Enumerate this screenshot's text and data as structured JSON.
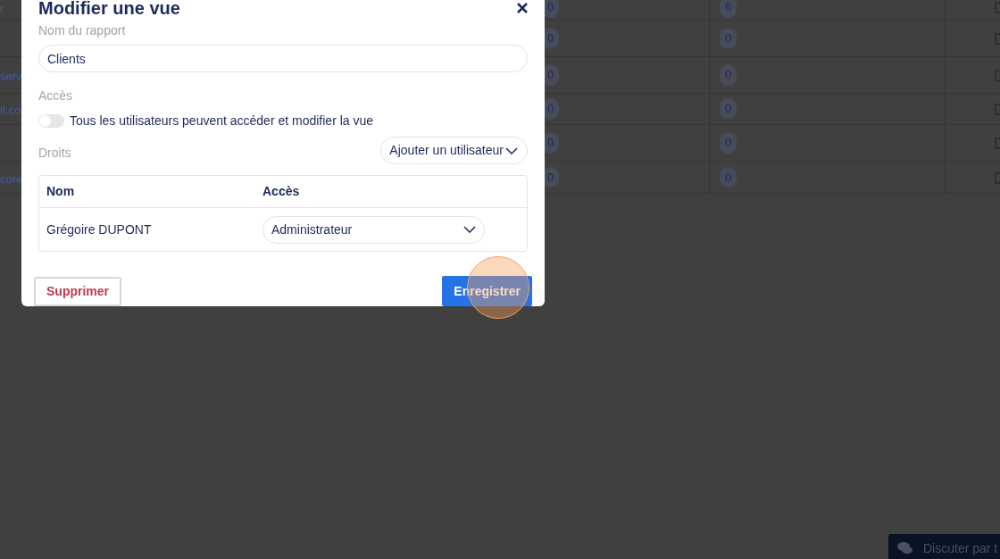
{
  "background_table": {
    "rows": [
      {
        "column_1": "r",
        "column_2": "0",
        "column_3": "6"
      },
      {
        "column_2": "0",
        "column_3": "0"
      },
      {
        "column_1": "serv",
        "column_2": "0",
        "column_3": "0"
      },
      {
        "column_1": "il.co",
        "column_2": "0",
        "column_3": "0"
      },
      {
        "column_2": "0",
        "column_3": "0"
      },
      {
        "column_1": "core",
        "column_2": "0",
        "column_3": "0"
      }
    ]
  },
  "dialog": {
    "title": "Modifier une vue",
    "report_name": {
      "label": "Nom du rapport",
      "value": "Clients"
    },
    "access": {
      "label": "Accès",
      "toggle": {
        "label": "Tous les utilisateurs peuvent accéder et modifier la vue",
        "on": false
      }
    },
    "rights": {
      "label": "Droits",
      "add_user": "Ajouter un utilisateur",
      "columns": [
        "Nom",
        "Accès"
      ],
      "rows": [
        {
          "name": "Grégoire DUPONT",
          "access": "Administrateur"
        }
      ]
    },
    "buttons": {
      "delete": "Supprimer",
      "save": "Enregistrer"
    }
  },
  "chat_button": {
    "label": "Discuter par t"
  }
}
